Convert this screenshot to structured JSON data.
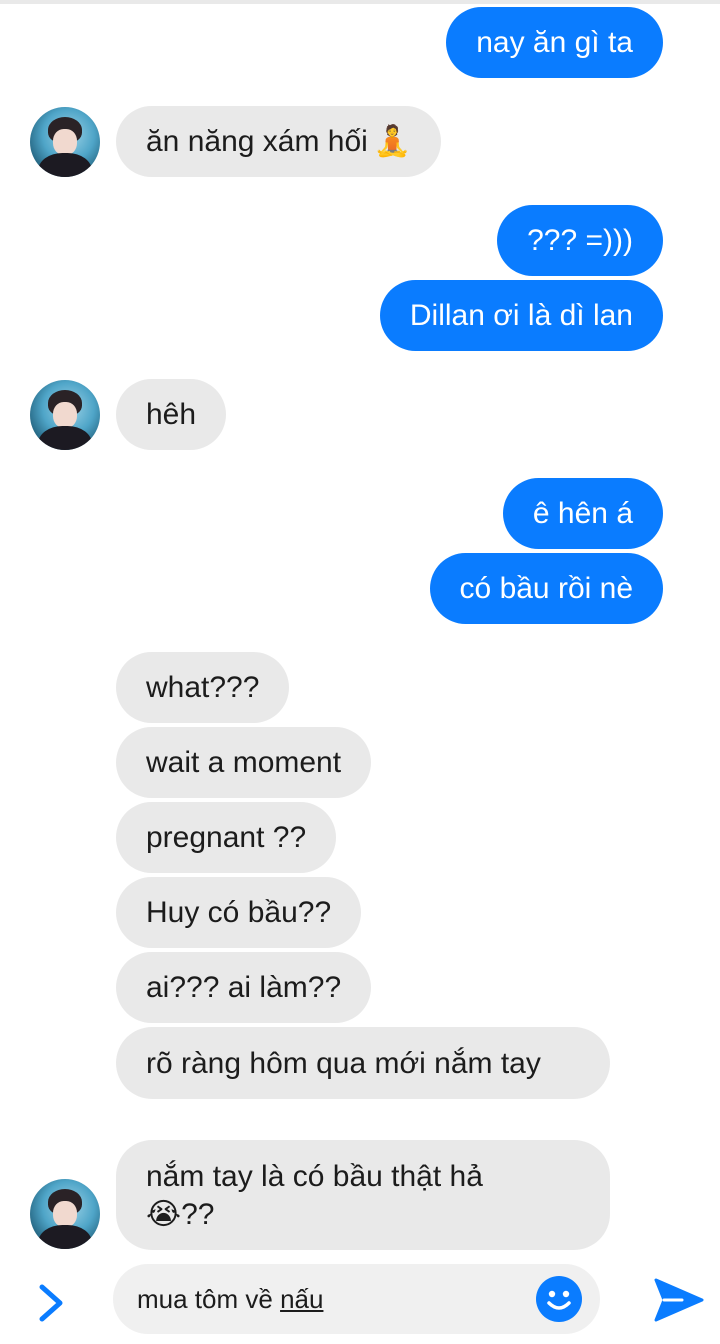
{
  "messages": {
    "m1": "nay ăn gì ta",
    "m2": "ăn năng xám hối",
    "m2_emoji": "🧘",
    "m3": "??? =)))",
    "m4": "Dillan ơi là dì lan",
    "m5": "hêh",
    "m6": "ê hên á",
    "m7": "có bầu rồi nè",
    "m8": "what???",
    "m9": "wait a moment",
    "m10": "pregnant ??",
    "m11": "Huy có bầu??",
    "m12": "ai??? ai làm??",
    "m13": "rõ ràng hôm qua mới nắm tay",
    "m14": "nắm tay là có bầu thật hả",
    "m14_emoji": "😭",
    "m14_tail": "??"
  },
  "composer": {
    "text_plain": "mua tôm về ",
    "text_underlined": "nấu"
  },
  "colors": {
    "outgoing_bubble": "#0a7cff",
    "incoming_bubble": "#e9e9e9",
    "accent": "#0a7cff"
  },
  "icons": {
    "expand": "chevron-right-icon",
    "emoji": "smile-icon",
    "send": "send-icon"
  }
}
